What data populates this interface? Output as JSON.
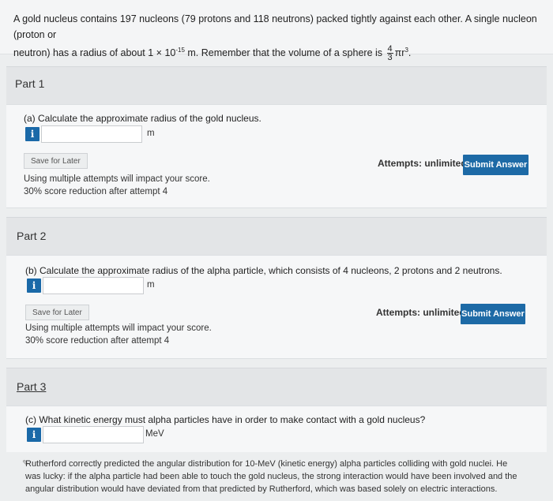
{
  "problem": {
    "text_line1": "A gold nucleus contains 197 nucleons (79 protons and 118 neutrons) packed tightly against each other. A single nucleon (proton or",
    "text_line2_a": "neutron) has a radius of about 1 × 10",
    "exp": "-15",
    "text_line2_b": " m. Remember that the volume of a sphere is ",
    "frac_num": "4",
    "frac_den": "3",
    "formula_tail": "πr",
    "formula_exp": "3",
    "formula_end": "."
  },
  "part1": {
    "title": "Part 1",
    "question": "(a) Calculate the approximate radius of the gold nucleus.",
    "info": "i",
    "input_value": "",
    "unit": "m",
    "save_label": "Save for Later",
    "attempts": "Attempts: unlimited",
    "submit_label": "Submit Answer",
    "note1": "Using multiple attempts will impact your score.",
    "note2": "30% score reduction after attempt 4"
  },
  "part2": {
    "title": "Part 2",
    "question": "(b) Calculate the approximate radius of the alpha particle, which consists of 4 nucleons, 2 protons and 2 neutrons.",
    "info": "i",
    "input_value": "",
    "unit": "m",
    "save_label": "Save for Later",
    "attempts": "Attempts: unlimited",
    "submit_label": "Submit Answer",
    "note1": "Using multiple attempts will impact your score.",
    "note2": "30% score reduction after attempt 4"
  },
  "part3": {
    "title": "Part 3",
    "question": "(c) What kinetic energy must alpha particles have in order to make contact with a gold nucleus?",
    "info": "i",
    "input_value": "",
    "unit": "MeV",
    "footnote_line1": "Rutherford correctly predicted the angular distribution for 10-MeV (kinetic energy) alpha particles colliding with gold nuclei. He",
    "footnote_line2": "was lucky: if the alpha particle had been able to touch the gold nucleus, the strong interaction would have been involved and the",
    "footnote_line3": "angular distribution would have deviated from that predicted by Rutherford, which was based solely on electric interactions."
  },
  "colors": {
    "accent": "#1d6aa6",
    "background": "#eceeef"
  }
}
